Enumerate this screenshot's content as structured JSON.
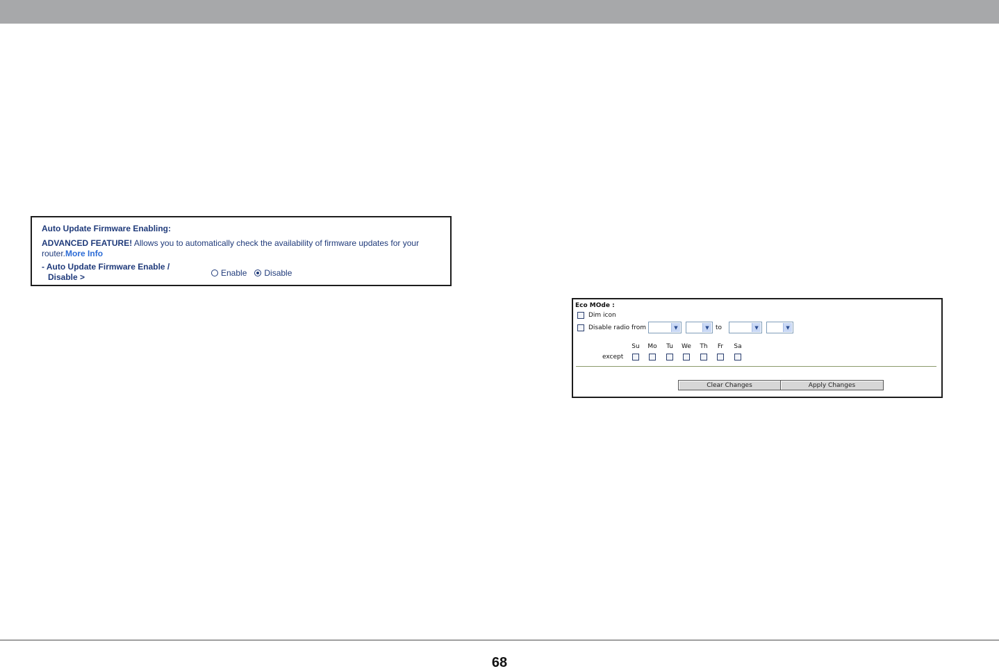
{
  "firmware_panel": {
    "title": "Auto Update Firmware Enabling:",
    "desc_bold": "ADVANCED FEATURE!",
    "desc_text": " Allows you to automatically check the availability of firmware updates for your router.",
    "more_info": "More Info",
    "label_line1": "- Auto Update Firmware Enable /",
    "label_line2": "Disable >",
    "options": [
      "Enable",
      "Disable"
    ],
    "selected": "Disable"
  },
  "eco_panel": {
    "title": "Eco MOde :",
    "dim_icon_label": "Dim icon",
    "disable_radio_label": "Disable radio from",
    "to_label": "to",
    "except_label": "except",
    "days": [
      "Su",
      "Mo",
      "Tu",
      "We",
      "Th",
      "Fr",
      "Sa"
    ],
    "clear_button": "Clear Changes",
    "apply_button": "Apply Changes"
  },
  "page_number": "68",
  "colors": {
    "top_bar": "#a7a8aa",
    "firmware_text": "#1f3a7a",
    "link": "#2b6bd6"
  }
}
